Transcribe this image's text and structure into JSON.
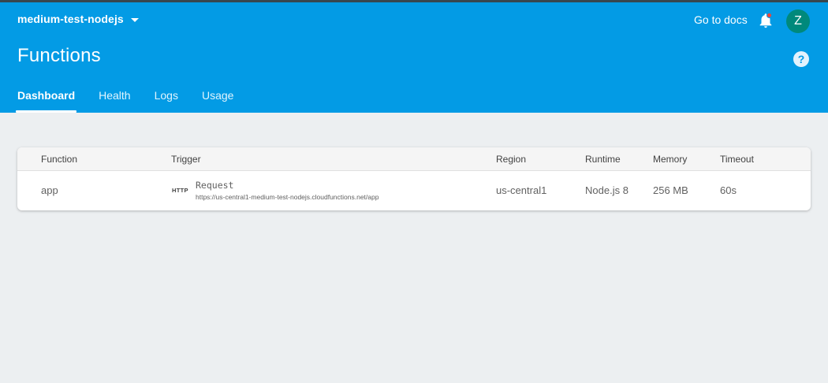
{
  "header": {
    "project_name": "medium-test-nodejs",
    "docs_label": "Go to docs",
    "avatar_initial": "Z",
    "page_title": "Functions",
    "help_symbol": "?"
  },
  "tabs": [
    {
      "label": "Dashboard",
      "active": true
    },
    {
      "label": "Health",
      "active": false
    },
    {
      "label": "Logs",
      "active": false
    },
    {
      "label": "Usage",
      "active": false
    }
  ],
  "table": {
    "columns": [
      "Function",
      "Trigger",
      "Region",
      "Runtime",
      "Memory",
      "Timeout"
    ],
    "rows": [
      {
        "function": "app",
        "trigger_badge": "HTTP",
        "trigger_type": "Request",
        "trigger_url": "https://us-central1-medium-test-nodejs.cloudfunctions.net/app",
        "region": "us-central1",
        "runtime": "Node.js 8",
        "memory": "256 MB",
        "timeout": "60s"
      }
    ]
  },
  "icons": {
    "dropdown": "chevron-down-icon",
    "notifications": "bell-icon",
    "help": "help-icon"
  },
  "colors": {
    "header_bg": "#039be5",
    "page_bg": "#eceff1",
    "avatar_bg": "#00897b",
    "notification_dot": "#f44336"
  }
}
